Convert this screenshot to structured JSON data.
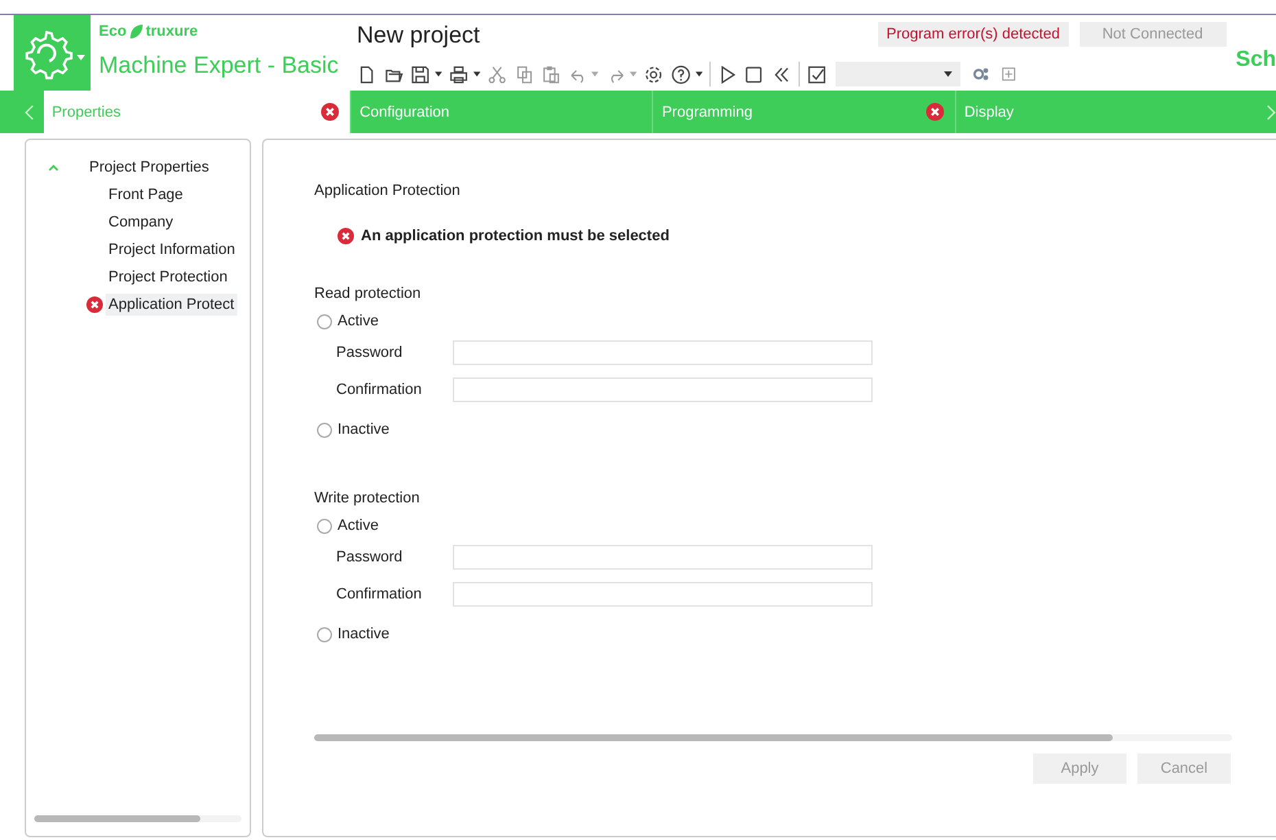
{
  "header": {
    "brand_prefix": "Eco",
    "brand_suffix": "truxure",
    "product": "Machine Expert - Basic",
    "project_title": "New project",
    "vendor_logo": "Sch",
    "status": [
      {
        "text": "Program error(s) detected",
        "kind": "error"
      },
      {
        "text": "Not Connected",
        "kind": "neutral"
      }
    ]
  },
  "tabs": [
    {
      "label": "Properties",
      "selected": true,
      "error": true
    },
    {
      "label": "Configuration",
      "selected": false,
      "error": false
    },
    {
      "label": "Programming",
      "selected": false,
      "error": true
    },
    {
      "label": "Display",
      "selected": false,
      "error": false
    }
  ],
  "tree": {
    "label": "Project Properties",
    "expanded": true,
    "children": [
      {
        "label": "Front Page",
        "selected": false,
        "error": false
      },
      {
        "label": "Company",
        "selected": false,
        "error": false
      },
      {
        "label": "Project Information",
        "selected": false,
        "error": false
      },
      {
        "label": "Project Protection",
        "selected": false,
        "error": false
      },
      {
        "label": "Application Protect",
        "selected": true,
        "error": true
      }
    ]
  },
  "form": {
    "title": "Application Protection",
    "error_message": "An application protection must be selected",
    "sections": [
      {
        "title": "Read protection",
        "options": [
          {
            "label": "Active",
            "selected": false,
            "fields": [
              {
                "label": "Password"
              },
              {
                "label": "Confirmation"
              }
            ]
          },
          {
            "label": "Inactive",
            "selected": false
          }
        ]
      },
      {
        "title": "Write protection",
        "options": [
          {
            "label": "Active",
            "selected": false,
            "fields": [
              {
                "label": "Password"
              },
              {
                "label": "Confirmation"
              }
            ]
          },
          {
            "label": "Inactive",
            "selected": false
          }
        ]
      }
    ],
    "buttons": [
      {
        "label": "Apply",
        "disabled": true
      },
      {
        "label": "Cancel",
        "disabled": true
      }
    ]
  }
}
